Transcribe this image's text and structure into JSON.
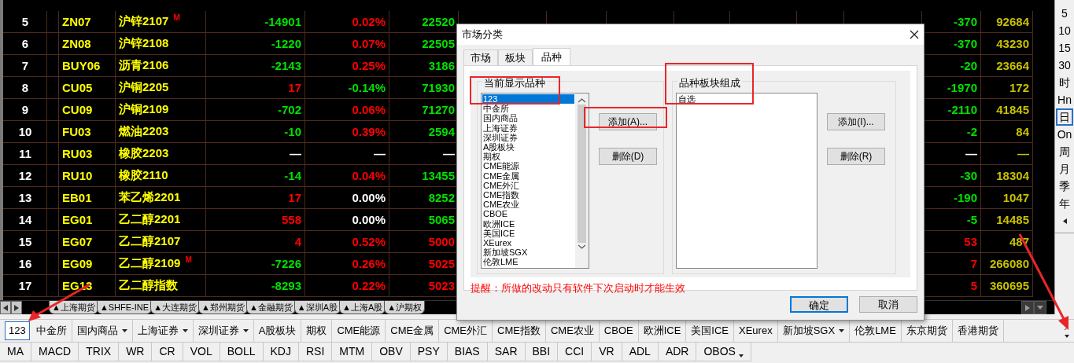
{
  "table": {
    "rows": [
      {
        "cells": [
          {
            "text": "5",
            "color": "#ffffff"
          },
          {
            "text": "ZN07",
            "color": "#ffff00"
          },
          {
            "text": "沪锌2107",
            "color": "#ffff00",
            "flag": "M"
          },
          {
            "text": "-14901",
            "color": "#00e000"
          },
          {
            "text": "0.02%",
            "color": "#ff0000"
          },
          {
            "text": "22520",
            "color": "#00e000"
          },
          null,
          null,
          null,
          null,
          null,
          null,
          null,
          {
            "text": "-370",
            "color": "#00e000"
          },
          {
            "text": "92684",
            "color": "#c8c000"
          }
        ]
      },
      {
        "cells": [
          {
            "text": "6",
            "color": "#ffffff"
          },
          {
            "text": "ZN08",
            "color": "#ffff00"
          },
          {
            "text": "沪锌2108",
            "color": "#ffff00"
          },
          {
            "text": "-1220",
            "color": "#00e000"
          },
          {
            "text": "0.07%",
            "color": "#ff0000"
          },
          {
            "text": "22505",
            "color": "#00e000"
          },
          null,
          null,
          null,
          null,
          null,
          null,
          null,
          {
            "text": "-370",
            "color": "#00e000"
          },
          {
            "text": "43230",
            "color": "#c8c000"
          }
        ]
      },
      {
        "cells": [
          {
            "text": "7",
            "color": "#ffffff"
          },
          {
            "text": "BUY06",
            "color": "#ffff00"
          },
          {
            "text": "沥青2106",
            "color": "#ffff00"
          },
          {
            "text": "-2143",
            "color": "#00e000"
          },
          {
            "text": "0.25%",
            "color": "#ff0000"
          },
          {
            "text": "3186",
            "color": "#00e000"
          },
          null,
          null,
          null,
          null,
          null,
          null,
          null,
          {
            "text": "-20",
            "color": "#00e000"
          },
          {
            "text": "23664",
            "color": "#c8c000"
          }
        ]
      },
      {
        "cells": [
          {
            "text": "8",
            "color": "#ffffff"
          },
          {
            "text": "CU05",
            "color": "#ffff00"
          },
          {
            "text": "沪铜2205",
            "color": "#ffff00"
          },
          {
            "text": "17",
            "color": "#ff0000"
          },
          {
            "text": "-0.14%",
            "color": "#00e000"
          },
          {
            "text": "71930",
            "color": "#00e000"
          },
          null,
          null,
          null,
          null,
          null,
          null,
          null,
          {
            "text": "-1970",
            "color": "#00e000"
          },
          {
            "text": "172",
            "color": "#c8c000"
          }
        ]
      },
      {
        "cells": [
          {
            "text": "9",
            "color": "#ffffff"
          },
          {
            "text": "CU09",
            "color": "#ffff00"
          },
          {
            "text": "沪铜2109",
            "color": "#ffff00"
          },
          {
            "text": "-702",
            "color": "#00e000"
          },
          {
            "text": "0.06%",
            "color": "#ff0000"
          },
          {
            "text": "71270",
            "color": "#00e000"
          },
          null,
          null,
          null,
          null,
          null,
          null,
          null,
          {
            "text": "-2110",
            "color": "#00e000"
          },
          {
            "text": "41845",
            "color": "#c8c000"
          }
        ]
      },
      {
        "cells": [
          {
            "text": "10",
            "color": "#ffffff"
          },
          {
            "text": "FU03",
            "color": "#ffff00"
          },
          {
            "text": "燃油2203",
            "color": "#ffff00"
          },
          {
            "text": "-10",
            "color": "#00e000"
          },
          {
            "text": "0.39%",
            "color": "#ff0000"
          },
          {
            "text": "2594",
            "color": "#00e000"
          },
          null,
          null,
          null,
          null,
          null,
          null,
          null,
          {
            "text": "-2",
            "color": "#00e000"
          },
          {
            "text": "84",
            "color": "#c8c000"
          }
        ]
      },
      {
        "cells": [
          {
            "text": "11",
            "color": "#ffffff"
          },
          {
            "text": "RU03",
            "color": "#ffff00"
          },
          {
            "text": "橡胶2203",
            "color": "#ffff00"
          },
          {
            "text": "—",
            "color": "#ffffff"
          },
          {
            "text": "—",
            "color": "#ffffff"
          },
          {
            "text": "—",
            "color": "#ffffff"
          },
          null,
          null,
          null,
          null,
          null,
          null,
          null,
          {
            "text": "—",
            "color": "#ffffff"
          },
          {
            "text": "—",
            "color": "#c8c000"
          }
        ]
      },
      {
        "cells": [
          {
            "text": "12",
            "color": "#ffffff"
          },
          {
            "text": "RU10",
            "color": "#ffff00"
          },
          {
            "text": "橡胶2110",
            "color": "#ffff00"
          },
          {
            "text": "-14",
            "color": "#00e000"
          },
          {
            "text": "0.04%",
            "color": "#ff0000"
          },
          {
            "text": "13455",
            "color": "#00e000"
          },
          null,
          null,
          null,
          null,
          null,
          null,
          null,
          {
            "text": "-30",
            "color": "#00e000"
          },
          {
            "text": "18304",
            "color": "#c8c000"
          }
        ]
      },
      {
        "cells": [
          {
            "text": "13",
            "color": "#ffffff"
          },
          {
            "text": "EB01",
            "color": "#ffff00"
          },
          {
            "text": "苯乙烯2201",
            "color": "#ffff00"
          },
          {
            "text": "17",
            "color": "#ff0000"
          },
          {
            "text": "0.00%",
            "color": "#ffffff"
          },
          {
            "text": "8252",
            "color": "#00e000"
          },
          null,
          null,
          null,
          null,
          null,
          null,
          null,
          {
            "text": "-190",
            "color": "#00e000"
          },
          {
            "text": "1047",
            "color": "#c8c000"
          }
        ]
      },
      {
        "cells": [
          {
            "text": "14",
            "color": "#ffffff"
          },
          {
            "text": "EG01",
            "color": "#ffff00"
          },
          {
            "text": "乙二醇2201",
            "color": "#ffff00"
          },
          {
            "text": "558",
            "color": "#ff0000"
          },
          {
            "text": "0.00%",
            "color": "#ffffff"
          },
          {
            "text": "5065",
            "color": "#00e000"
          },
          null,
          null,
          null,
          null,
          null,
          null,
          null,
          {
            "text": "-5",
            "color": "#00e000"
          },
          {
            "text": "14485",
            "color": "#c8c000"
          }
        ]
      },
      {
        "cells": [
          {
            "text": "15",
            "color": "#ffffff"
          },
          {
            "text": "EG07",
            "color": "#ffff00"
          },
          {
            "text": "乙二醇2107",
            "color": "#ffff00"
          },
          {
            "text": "4",
            "color": "#ff0000"
          },
          {
            "text": "0.52%",
            "color": "#ff0000"
          },
          {
            "text": "5000",
            "color": "#ff0000"
          },
          null,
          null,
          null,
          null,
          null,
          null,
          null,
          {
            "text": "53",
            "color": "#ff0000"
          },
          {
            "text": "487",
            "color": "#c8c000"
          }
        ]
      },
      {
        "cells": [
          {
            "text": "16",
            "color": "#ffffff"
          },
          {
            "text": "EG09",
            "color": "#ffff00"
          },
          {
            "text": "乙二醇2109",
            "color": "#ffff00",
            "flag": "M"
          },
          {
            "text": "-7226",
            "color": "#00e000"
          },
          {
            "text": "0.26%",
            "color": "#ff0000"
          },
          {
            "text": "5025",
            "color": "#ff0000"
          },
          null,
          null,
          null,
          null,
          null,
          null,
          null,
          {
            "text": "7",
            "color": "#ff0000"
          },
          {
            "text": "266080",
            "color": "#c8c000"
          }
        ]
      },
      {
        "cells": [
          {
            "text": "17",
            "color": "#ffffff"
          },
          {
            "text": "EG13",
            "color": "#ffff00"
          },
          {
            "text": "乙二醇指数",
            "color": "#ffff00"
          },
          {
            "text": "-8293",
            "color": "#00e000"
          },
          {
            "text": "0.22%",
            "color": "#ff0000"
          },
          {
            "text": "5023",
            "color": "#ff0000"
          },
          null,
          null,
          null,
          null,
          null,
          null,
          null,
          {
            "text": "5",
            "color": "#ff0000"
          },
          {
            "text": "360695",
            "color": "#c8c000"
          }
        ]
      }
    ]
  },
  "sheet_tabs": [
    "▲上海期货",
    "▲SHFE-INE",
    "▲大连期货",
    "▲郑州期货",
    "▲金融期货",
    "▲深圳A股",
    "▲上海A股",
    "▲沪期权"
  ],
  "period_bar": {
    "items": [
      {
        "label": "5",
        "selected": false
      },
      {
        "label": "10",
        "selected": false
      },
      {
        "label": "15",
        "selected": false
      },
      {
        "label": "30",
        "selected": false
      },
      {
        "label": "时",
        "selected": false
      },
      {
        "label": "Hn",
        "selected": false
      },
      {
        "label": "日",
        "selected": true
      },
      {
        "label": "On",
        "selected": false
      },
      {
        "label": "周",
        "selected": false
      },
      {
        "label": "月",
        "selected": false
      },
      {
        "label": "季",
        "selected": false
      },
      {
        "label": "年",
        "selected": false
      }
    ]
  },
  "dialog": {
    "title": "市场分类",
    "tabs": [
      {
        "label": "市场",
        "selected": false
      },
      {
        "label": "板块",
        "selected": false
      },
      {
        "label": "品种",
        "selected": true
      }
    ],
    "left_group": {
      "label": "当前显示品种",
      "items": [
        {
          "label": "123",
          "selected": true
        },
        {
          "label": "中金所",
          "selected": false
        },
        {
          "label": "国内商品",
          "selected": false
        },
        {
          "label": "上海证券",
          "selected": false
        },
        {
          "label": "深圳证券",
          "selected": false
        },
        {
          "label": "A股板块",
          "selected": false
        },
        {
          "label": "期权",
          "selected": false
        },
        {
          "label": "CME能源",
          "selected": false
        },
        {
          "label": "CME金属",
          "selected": false
        },
        {
          "label": "CME外汇",
          "selected": false
        },
        {
          "label": "CME指数",
          "selected": false
        },
        {
          "label": "CME农业",
          "selected": false
        },
        {
          "label": "CBOE",
          "selected": false
        },
        {
          "label": "欧洲ICE",
          "selected": false
        },
        {
          "label": "美国ICE",
          "selected": false
        },
        {
          "label": "XEurex",
          "selected": false
        },
        {
          "label": "新加坡SGX",
          "selected": false
        },
        {
          "label": "伦敦LME",
          "selected": false
        }
      ],
      "add_button": "添加(A)...",
      "delete_button": "删除(D)"
    },
    "right_group": {
      "label": "品种板块组成",
      "items": [
        {
          "label": "自选",
          "selected": false
        }
      ],
      "add_button": "添加(I)...",
      "delete_button": "删除(R)"
    },
    "notice": "提醒：所做的改动只有软件下次启动时才能生效",
    "buttons": [
      {
        "label": "确定",
        "default": true
      },
      {
        "label": "取消",
        "default": false
      }
    ]
  },
  "market_bar": [
    {
      "label": "123",
      "selected": true,
      "dropdown": false
    },
    {
      "label": "中金所",
      "selected": false,
      "dropdown": false
    },
    {
      "label": "国内商品",
      "selected": false,
      "dropdown": true
    },
    {
      "label": "上海证券",
      "selected": false,
      "dropdown": true
    },
    {
      "label": "深圳证券",
      "selected": false,
      "dropdown": true
    },
    {
      "label": "A股板块",
      "selected": false,
      "dropdown": false
    },
    {
      "label": "期权",
      "selected": false,
      "dropdown": false
    },
    {
      "label": "CME能源",
      "selected": false,
      "dropdown": false
    },
    {
      "label": "CME金属",
      "selected": false,
      "dropdown": false
    },
    {
      "label": "CME外汇",
      "selected": false,
      "dropdown": false
    },
    {
      "label": "CME指数",
      "selected": false,
      "dropdown": false
    },
    {
      "label": "CME农业",
      "selected": false,
      "dropdown": false
    },
    {
      "label": "CBOE",
      "selected": false,
      "dropdown": false
    },
    {
      "label": "欧洲ICE",
      "selected": false,
      "dropdown": false
    },
    {
      "label": "美国ICE",
      "selected": false,
      "dropdown": false
    },
    {
      "label": "XEurex",
      "selected": false,
      "dropdown": false
    },
    {
      "label": "新加坡SGX",
      "selected": false,
      "dropdown": true
    },
    {
      "label": "伦敦LME",
      "selected": false,
      "dropdown": false
    },
    {
      "label": "东京期货",
      "selected": false,
      "dropdown": false
    },
    {
      "label": "香港期货",
      "selected": false,
      "dropdown": false
    }
  ],
  "indicator_bar": [
    {
      "label": "MA",
      "dropdown": false
    },
    {
      "label": "MACD",
      "dropdown": false
    },
    {
      "label": "TRIX",
      "dropdown": false
    },
    {
      "label": "WR",
      "dropdown": false
    },
    {
      "label": "CR",
      "dropdown": false
    },
    {
      "label": "VOL",
      "dropdown": false
    },
    {
      "label": "BOLL",
      "dropdown": false
    },
    {
      "label": "KDJ",
      "dropdown": false
    },
    {
      "label": "RSI",
      "dropdown": false
    },
    {
      "label": "MTM",
      "dropdown": false
    },
    {
      "label": "OBV",
      "dropdown": false
    },
    {
      "label": "PSY",
      "dropdown": false
    },
    {
      "label": "BIAS",
      "dropdown": false
    },
    {
      "label": "SAR",
      "dropdown": false
    },
    {
      "label": "BBI",
      "dropdown": false
    },
    {
      "label": "CCI",
      "dropdown": false
    },
    {
      "label": "VR",
      "dropdown": false
    },
    {
      "label": "ADL",
      "dropdown": false
    },
    {
      "label": "ADR",
      "dropdown": false
    },
    {
      "label": "OBOS",
      "dropdown": true
    }
  ]
}
